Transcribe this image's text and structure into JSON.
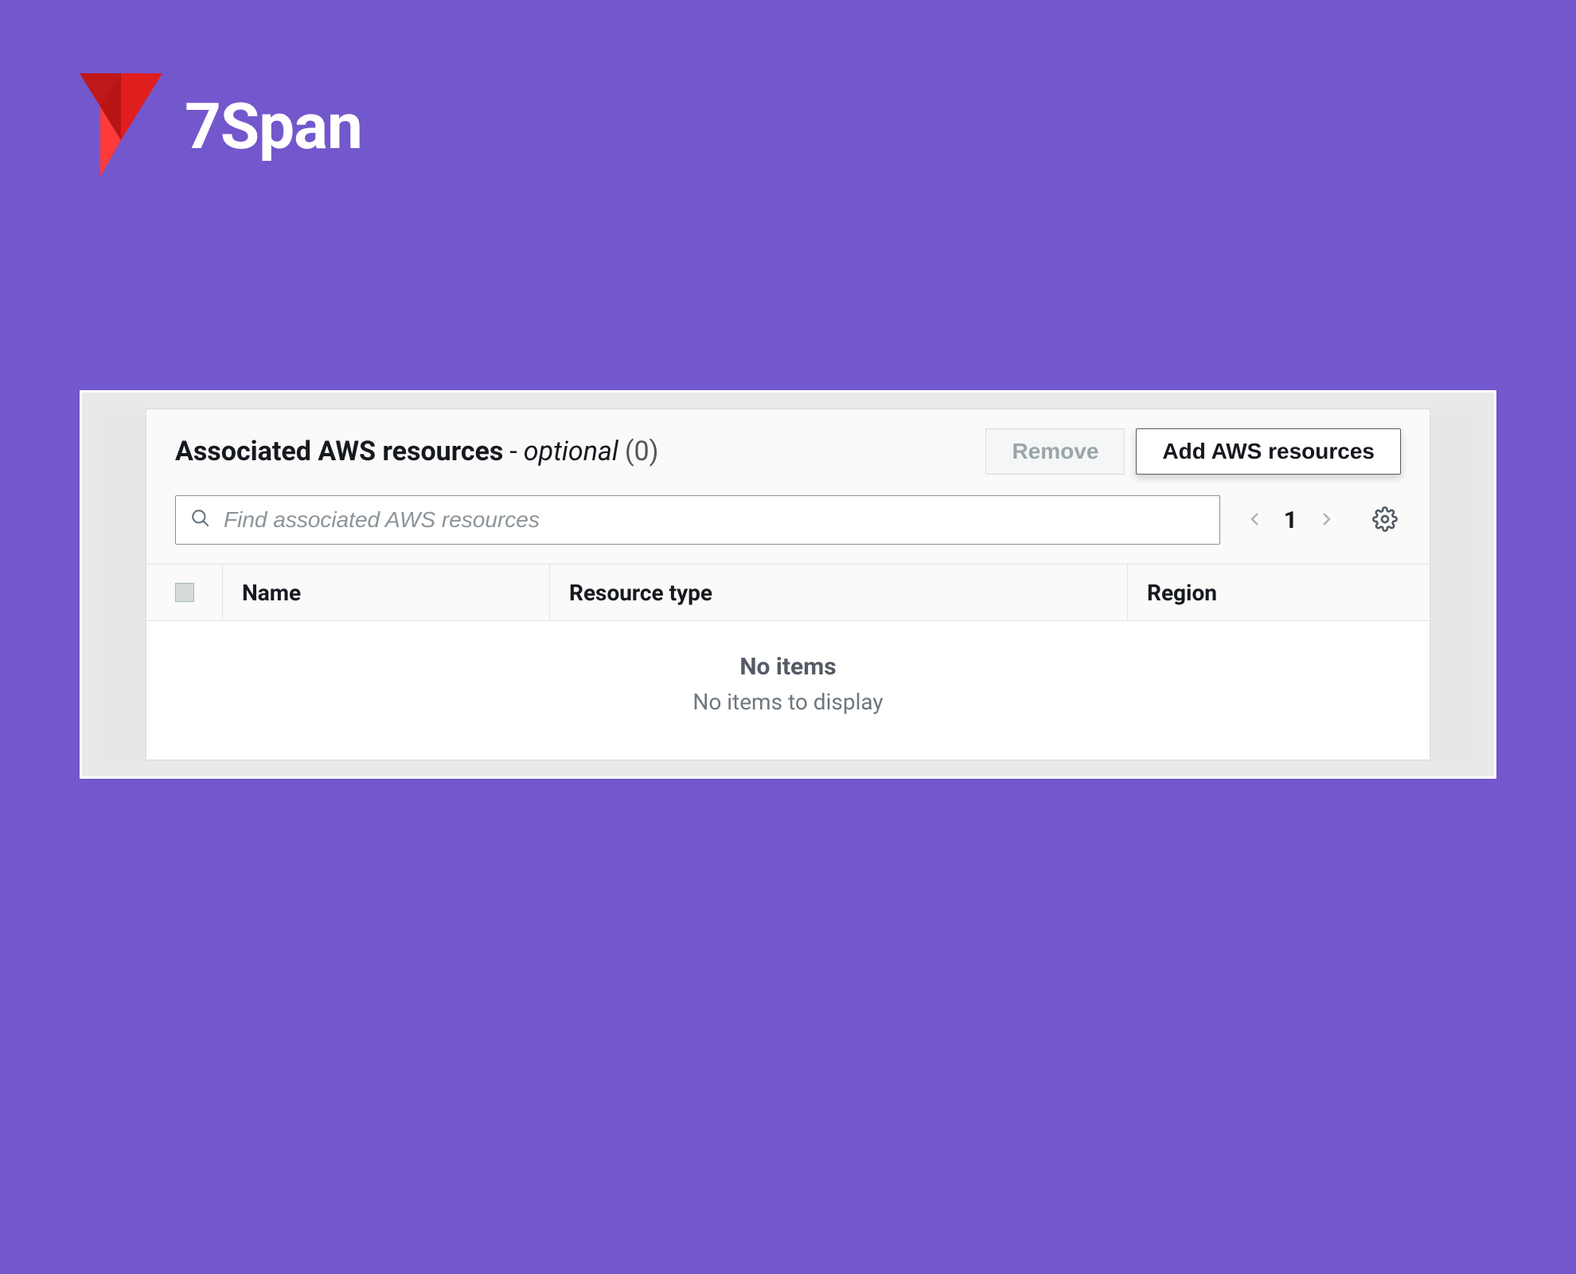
{
  "brand": {
    "name": "7Span"
  },
  "panel": {
    "title_main": "Associated AWS resources",
    "title_dash": "-",
    "title_optional": "optional",
    "title_count": "(0)",
    "remove_label": "Remove",
    "add_label": "Add AWS resources",
    "search_placeholder": "Find associated AWS resources",
    "pager": {
      "page": "1"
    },
    "columns": {
      "name": "Name",
      "type": "Resource type",
      "region": "Region"
    },
    "empty": {
      "title": "No items",
      "subtitle": "No items to display"
    }
  }
}
